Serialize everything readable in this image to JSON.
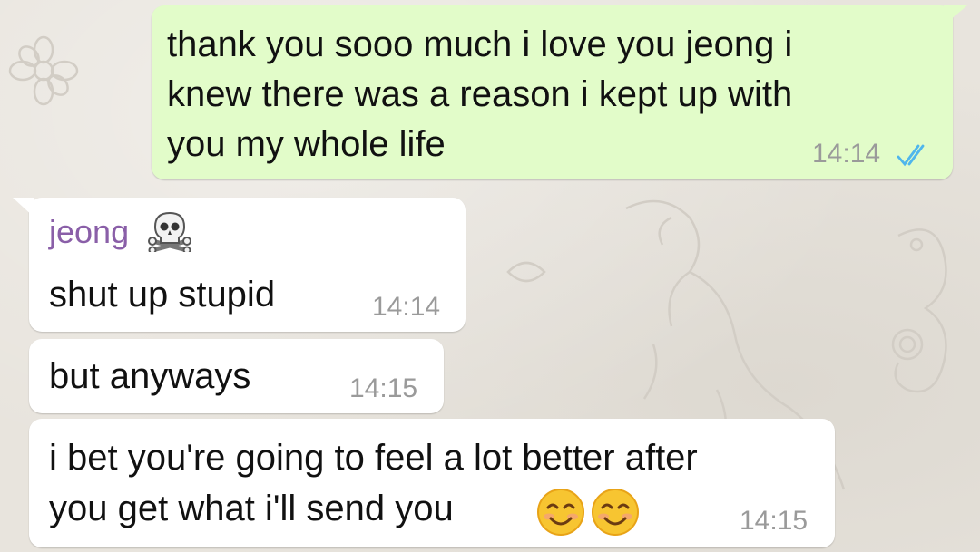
{
  "colors": {
    "outgoing_bubble": "#e2fcc9",
    "incoming_bubble": "#ffffff",
    "sender_name": "#8a5fa8",
    "read_ticks": "#4fb6ec",
    "timestamp": "#9a9a9a"
  },
  "messages": [
    {
      "direction": "outgoing",
      "lines": [
        "thank you sooo much i love you jeong i",
        "knew there was a reason i kept up with",
        "you my whole life"
      ],
      "time": "14:14",
      "status_icon": "double-check-read-icon"
    },
    {
      "direction": "incoming",
      "sender": "jeong",
      "sender_icon": "skull-crossbones-icon",
      "lines": [
        "shut up stupid"
      ],
      "time": "14:14"
    },
    {
      "direction": "incoming",
      "lines": [
        "but anyways"
      ],
      "time": "14:15"
    },
    {
      "direction": "incoming",
      "lines": [
        "i bet you're going to feel a lot better after",
        "you get what i'll send you"
      ],
      "emoji_icons": [
        "smiling-face-icon",
        "smiling-face-icon"
      ],
      "time": "14:15"
    }
  ]
}
